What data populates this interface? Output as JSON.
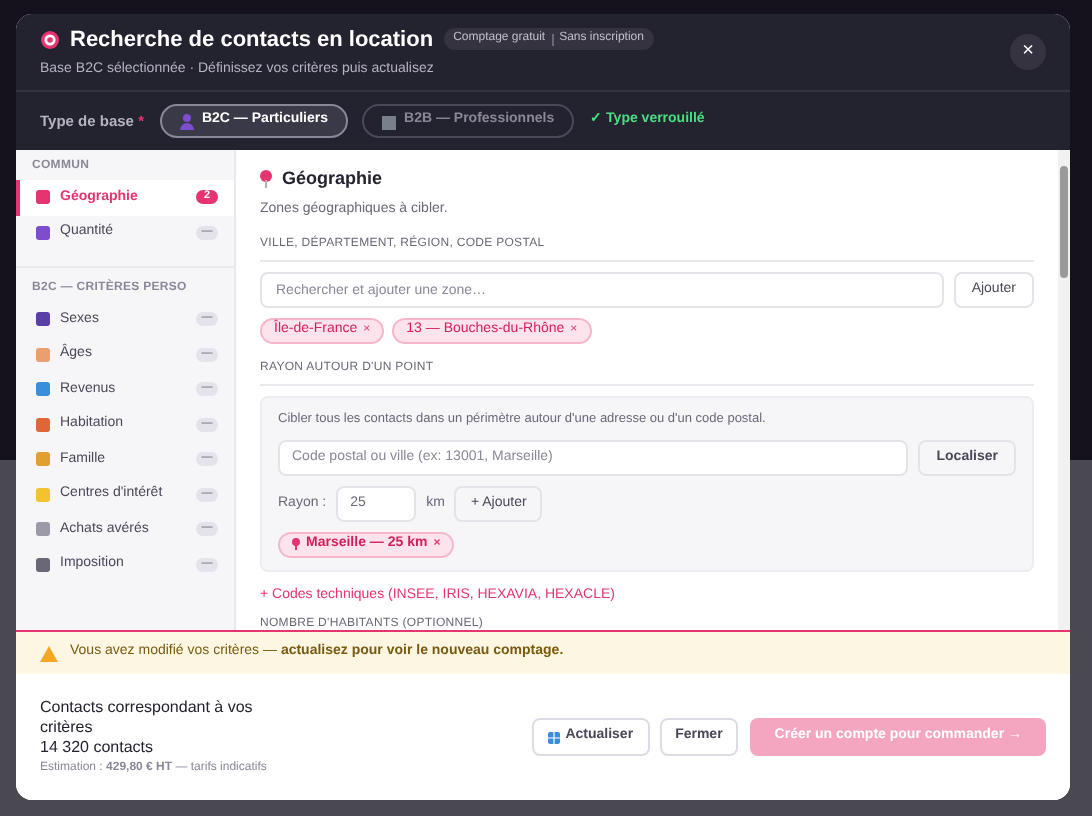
{
  "header": {
    "title": "Recherche de contacts en location",
    "badges": [
      "Comptage gratuit",
      "Sans inscription"
    ],
    "subtitle": "Base B2C sélectionnée · Définissez vos critères puis actualisez",
    "close": "×"
  },
  "base_type": {
    "label": "Type de base",
    "required_mark": "*",
    "options": [
      {
        "label": "B2C — Particuliers",
        "selected": true
      },
      {
        "label": "B2B — Professionnels",
        "selected": false
      }
    ],
    "lock_note": "✓ Type verrouillé"
  },
  "sidebar": {
    "sections": [
      {
        "title": "COMMUN",
        "items": [
          {
            "label": "Géographie",
            "count": "2",
            "selected": true
          },
          {
            "label": "Quantité",
            "count": "—",
            "selected": false
          }
        ]
      },
      {
        "title": "B2C — CRITÈRES PERSO",
        "items": [
          {
            "label": "Sexes",
            "count": "—",
            "selected": false
          },
          {
            "label": "Âges",
            "count": "—",
            "selected": false
          },
          {
            "label": "Revenus",
            "count": "—",
            "selected": false
          },
          {
            "label": "Habitation",
            "count": "—",
            "selected": false
          },
          {
            "label": "Famille",
            "count": "—",
            "selected": false
          },
          {
            "label": "Centres d'intérêt",
            "count": "—",
            "selected": false
          },
          {
            "label": "Achats avérés",
            "count": "—",
            "selected": false
          },
          {
            "label": "Imposition",
            "count": "—",
            "selected": false
          }
        ]
      }
    ]
  },
  "panel": {
    "title": "Géographie",
    "subtitle": "Zones géographiques à cibler.",
    "zones": {
      "label": "VILLE, DÉPARTEMENT, RÉGION, CODE POSTAL",
      "placeholder": "Rechercher et ajouter une zone…",
      "button": "Ajouter",
      "tags": [
        "Île-de-France",
        "13 — Bouches-du-Rhône"
      ],
      "remove": "×"
    },
    "radius": {
      "label": "RAYON AUTOUR D'UN POINT",
      "description": "Cibler tous les contacts dans un périmètre autour d'une adresse ou d'un code postal.",
      "placeholder": "Code postal ou ville (ex: 13001, Marseille)",
      "locate_button": "Localiser",
      "radius_label": "Rayon :",
      "radius_value": "25",
      "unit": "km",
      "add_button": "+ Ajouter",
      "tags": [
        "Marseille — 25 km"
      ],
      "remove": "×"
    },
    "codes_link": "+ Codes techniques (INSEE, IRIS, HEXAVIA, HEXACLE)",
    "next_section": "NOMBRE D'HABITANTS (OPTIONNEL)"
  },
  "warning": "Vous avez modifié vos critères — **actualisez pour voir le nouveau comptage.**",
  "footer": {
    "caption": "Contacts correspondant à vos critères",
    "count": "14 320 contacts",
    "estimate": "Estimation : **429,80 € HT**",
    "estimate_note": "— tarifs indicatifs",
    "buttons": [
      {
        "kind": "secondary",
        "label": "Actualiser",
        "disabled": false
      },
      {
        "kind": "plain",
        "label": "Fermer",
        "disabled": false
      },
      {
        "kind": "primary",
        "label": "Créer un compte pour commander →",
        "disabled": true
      }
    ]
  }
}
